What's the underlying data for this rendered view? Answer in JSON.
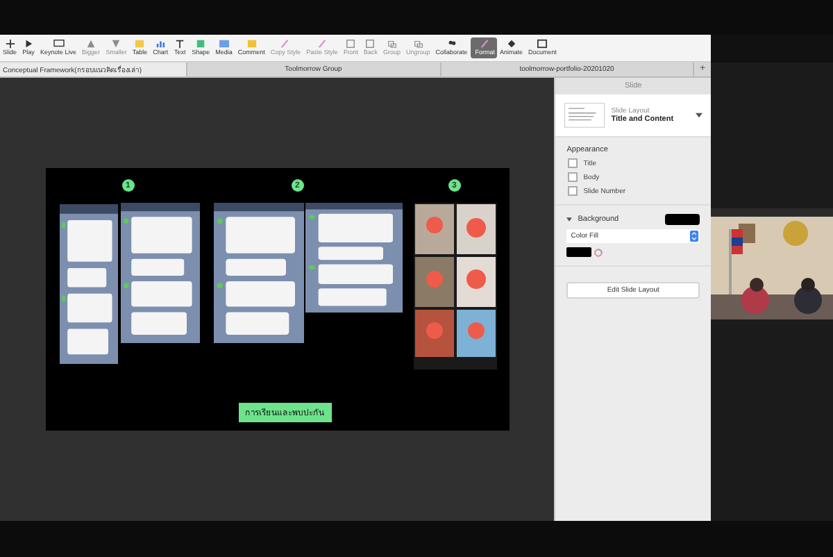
{
  "toolbar": [
    {
      "label": "Slide",
      "disabled": false,
      "selected": false
    },
    {
      "label": "Play",
      "disabled": false,
      "selected": false
    },
    {
      "label": "Keynote Live",
      "disabled": false,
      "selected": false
    },
    {
      "label": "Bigger",
      "disabled": true,
      "selected": false
    },
    {
      "label": "Smaller",
      "disabled": true,
      "selected": false
    },
    {
      "label": "Table",
      "disabled": false,
      "selected": false
    },
    {
      "label": "Chart",
      "disabled": false,
      "selected": false
    },
    {
      "label": "Text",
      "disabled": false,
      "selected": false
    },
    {
      "label": "Shape",
      "disabled": false,
      "selected": false
    },
    {
      "label": "Media",
      "disabled": false,
      "selected": false
    },
    {
      "label": "Comment",
      "disabled": false,
      "selected": false
    },
    {
      "label": "Copy Style",
      "disabled": true,
      "selected": false
    },
    {
      "label": "Paste Style",
      "disabled": true,
      "selected": false
    },
    {
      "label": "Front",
      "disabled": true,
      "selected": false
    },
    {
      "label": "Back",
      "disabled": true,
      "selected": false
    },
    {
      "label": "Group",
      "disabled": true,
      "selected": false
    },
    {
      "label": "Ungroup",
      "disabled": true,
      "selected": false
    },
    {
      "label": "Collaborate",
      "disabled": false,
      "selected": false
    },
    {
      "label": "Format",
      "disabled": false,
      "selected": true
    },
    {
      "label": "Animate",
      "disabled": false,
      "selected": false
    },
    {
      "label": "Document",
      "disabled": false,
      "selected": false
    }
  ],
  "tabs": [
    {
      "label": "Conceptual Framework(กรอบแนวคิดเรื่องเล่า)",
      "selected": true
    },
    {
      "label": "Toolmorrow Group",
      "selected": false
    },
    {
      "label": "toolmorrow-portfolio-20201020",
      "selected": false
    }
  ],
  "new_tab_button": "+",
  "slide": {
    "steps": [
      {
        "number": "1"
      },
      {
        "number": "2"
      },
      {
        "number": "3"
      }
    ],
    "caption": "การเรียนและพบปะกัน"
  },
  "inspector": {
    "title": "Slide",
    "layout_label": "Slide Layout",
    "layout_name": "Title and Content",
    "appearance_title": "Appearance",
    "appearance": [
      {
        "label": "Title",
        "checked": false
      },
      {
        "label": "Body",
        "checked": false
      },
      {
        "label": "Slide Number",
        "checked": false
      }
    ],
    "background": {
      "label": "Background",
      "expanded": true,
      "color": "#000000",
      "fill": "Color Fill"
    },
    "edit_button": "Edit Slide Layout"
  }
}
